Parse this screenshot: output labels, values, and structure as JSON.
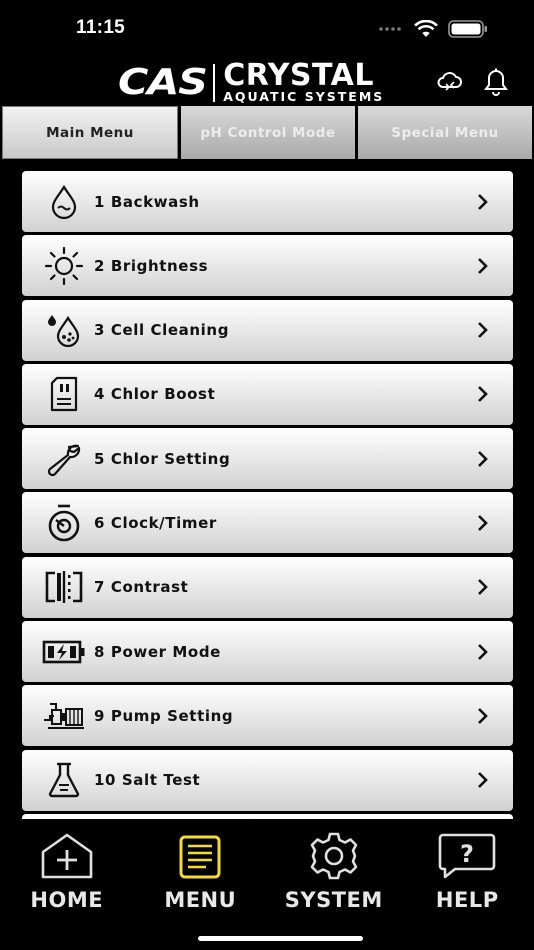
{
  "status": {
    "time": "11:15"
  },
  "logo": {
    "mark": "CAS",
    "line1": "CRYSTAL",
    "line2": "AQUATIC SYSTEMS"
  },
  "tabs": [
    {
      "label": "Main Menu",
      "active": true
    },
    {
      "label": "pH Control Mode",
      "active": false
    },
    {
      "label": "Special Menu",
      "active": false
    }
  ],
  "menu": {
    "items": [
      {
        "label": "1 Backwash",
        "icon": "water-drop-icon"
      },
      {
        "label": "2 Brightness",
        "icon": "sun-icon"
      },
      {
        "label": "3 Cell Cleaning",
        "icon": "drops-icon"
      },
      {
        "label": "4 Chlor Boost",
        "icon": "sd-card-icon"
      },
      {
        "label": "5 Chlor Setting",
        "icon": "wrench-icon"
      },
      {
        "label": "6 Clock/Timer",
        "icon": "stopwatch-icon"
      },
      {
        "label": "7 Contrast",
        "icon": "contrast-icon"
      },
      {
        "label": "8 Power Mode",
        "icon": "battery-charging-icon"
      },
      {
        "label": "9 Pump Setting",
        "icon": "pump-icon"
      },
      {
        "label": "10 Salt Test",
        "icon": "flask-icon"
      }
    ]
  },
  "nav": {
    "home": "HOME",
    "menu": "MENU",
    "system": "SYSTEM",
    "help": "HELP",
    "active": "menu",
    "active_color": "#f5dd2a"
  }
}
